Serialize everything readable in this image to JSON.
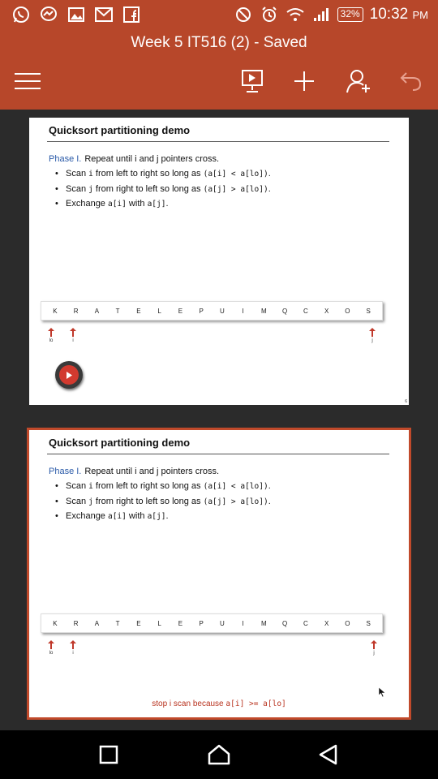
{
  "status_bar": {
    "icons_left": [
      "whatsapp-icon",
      "messenger-icon",
      "gallery-icon",
      "gmail-icon",
      "facebook-icon"
    ],
    "icons_right": [
      "do-not-disturb-icon",
      "alarm-icon",
      "wifi-icon",
      "signal-icon"
    ],
    "battery": "32%",
    "time": "10:32",
    "ampm": "PM"
  },
  "app_bar": {
    "title": "Week 5 IT516 (2) - Saved",
    "icons": [
      "menu-icon",
      "present-icon",
      "add-icon",
      "share-person-icon",
      "undo-icon"
    ]
  },
  "slides": [
    {
      "title": "Quicksort partitioning demo",
      "phase_label": "Phase I.",
      "phase_text": "Repeat until i and j pointers cross.",
      "bullets": [
        {
          "pre": "Scan ",
          "code1": "i",
          "mid": " from left to right so long as ",
          "code2": "(a[i] < a[lo])",
          "post": "."
        },
        {
          "pre": "Scan ",
          "code1": "j",
          "mid": " from right to left so long as ",
          "code2": "(a[j] > a[lo])",
          "post": "."
        },
        {
          "pre": "Exchange ",
          "code1": "a[i]",
          "mid": " with ",
          "code2": "a[j]",
          "post": "."
        }
      ],
      "array": [
        "K",
        "R",
        "A",
        "T",
        "E",
        "L",
        "E",
        "P",
        "U",
        "I",
        "M",
        "Q",
        "C",
        "X",
        "O",
        "S"
      ],
      "pointers": {
        "lo": "lo",
        "i": "i",
        "j": "j"
      },
      "page_number": "6"
    },
    {
      "title": "Quicksort partitioning demo",
      "phase_label": "Phase I.",
      "phase_text": "Repeat until i and j pointers cross.",
      "bullets": [
        {
          "pre": "Scan ",
          "code1": "i",
          "mid": " from left to right so long as ",
          "code2": "(a[i] < a[lo])",
          "post": "."
        },
        {
          "pre": "Scan ",
          "code1": "j",
          "mid": " from right to left so long as ",
          "code2": "(a[j] > a[lo])",
          "post": "."
        },
        {
          "pre": "Exchange ",
          "code1": "a[i]",
          "mid": " with ",
          "code2": "a[j]",
          "post": "."
        }
      ],
      "array": [
        "K",
        "R",
        "A",
        "T",
        "E",
        "L",
        "E",
        "P",
        "U",
        "I",
        "M",
        "Q",
        "C",
        "X",
        "O",
        "S"
      ],
      "pointers": {
        "lo": "lo",
        "i": "i",
        "j": "j"
      },
      "caption_pre": "stop i scan because ",
      "caption_code": "a[i] >= a[lo]"
    }
  ],
  "nav_bar": {
    "icons": [
      "recents-icon",
      "home-icon",
      "back-icon"
    ]
  },
  "colors": {
    "accent": "#b7472a",
    "selected_border": "#c14a2b",
    "phase_blue": "#2a5aa8",
    "pointer_red": "#c0392b"
  }
}
